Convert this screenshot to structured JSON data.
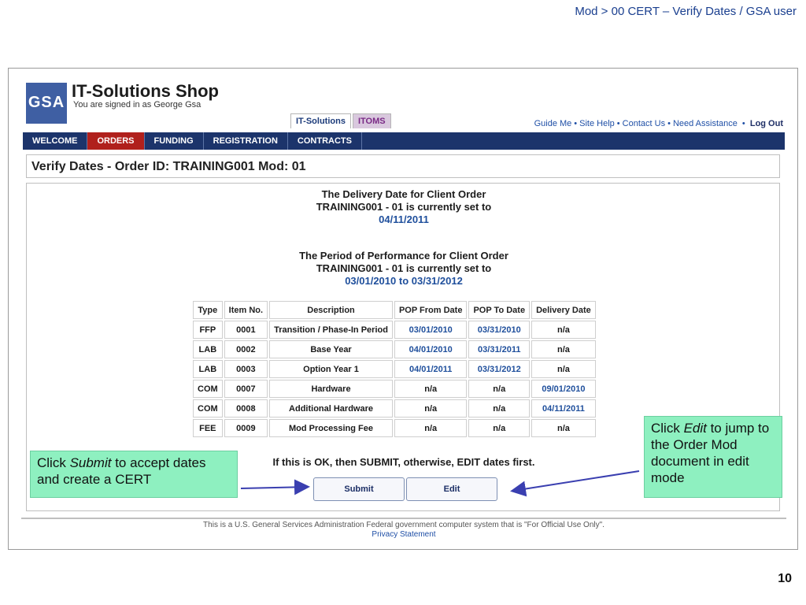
{
  "slide": {
    "title": "Mod > 00 CERT – Verify Dates / GSA user",
    "number": "10"
  },
  "header": {
    "logo_text": "GSA",
    "app_title": "IT-Solutions Shop",
    "signed_in": "You are signed in as George Gsa",
    "portal_tabs": [
      "IT-Solutions",
      "ITOMS"
    ],
    "help_links": [
      "Guide Me",
      "Site Help",
      "Contact Us",
      "Need Assistance",
      "Log Out"
    ],
    "nav": [
      "WELCOME",
      "ORDERS",
      "FUNDING",
      "REGISTRATION",
      "CONTRACTS"
    ]
  },
  "page": {
    "title": "Verify Dates - Order ID: TRAINING001 Mod: 01",
    "delivery_msg": {
      "line1": "The Delivery Date for Client Order",
      "line2": "TRAINING001 - 01 is currently set to",
      "value": "04/11/2011"
    },
    "pop_msg": {
      "line1": "The Period of Performance for Client Order",
      "line2": "TRAINING001 - 01 is currently set to",
      "value": "03/01/2010 to 03/31/2012"
    },
    "table": {
      "headers": [
        "Type",
        "Item No.",
        "Description",
        "POP From Date",
        "POP To Date",
        "Delivery Date"
      ],
      "rows": [
        [
          "FFP",
          "0001",
          "Transition / Phase-In Period",
          "03/01/2010",
          "03/31/2010",
          "n/a"
        ],
        [
          "LAB",
          "0002",
          "Base Year",
          "04/01/2010",
          "03/31/2011",
          "n/a"
        ],
        [
          "LAB",
          "0003",
          "Option Year 1",
          "04/01/2011",
          "03/31/2012",
          "n/a"
        ],
        [
          "COM",
          "0007",
          "Hardware",
          "n/a",
          "n/a",
          "09/01/2010"
        ],
        [
          "COM",
          "0008",
          "Additional Hardware",
          "n/a",
          "n/a",
          "04/11/2011"
        ],
        [
          "FEE",
          "0009",
          "Mod Processing Fee",
          "n/a",
          "n/a",
          "n/a"
        ]
      ]
    },
    "confirm_text": "If this is OK, then SUBMIT, otherwise, EDIT dates first.",
    "submit_label": "Submit",
    "edit_label": "Edit"
  },
  "footer": {
    "notice": "This is a U.S. General Services Administration Federal government computer system that is \"For Official Use Only\".",
    "privacy": "Privacy Statement"
  },
  "callouts": {
    "left": {
      "pre": "Click ",
      "em": "Submit",
      "post": " to accept dates and create a  CERT"
    },
    "right": {
      "pre": "Click ",
      "em": "Edit",
      "post": " to jump to the Order Mod document in edit mode"
    }
  },
  "colors": {
    "nav_bg": "#1c346b",
    "nav_active": "#b0201c",
    "callout_bg": "#8ef0c0",
    "link": "#1f4fa6",
    "value_blue": "#1f4f9c"
  }
}
